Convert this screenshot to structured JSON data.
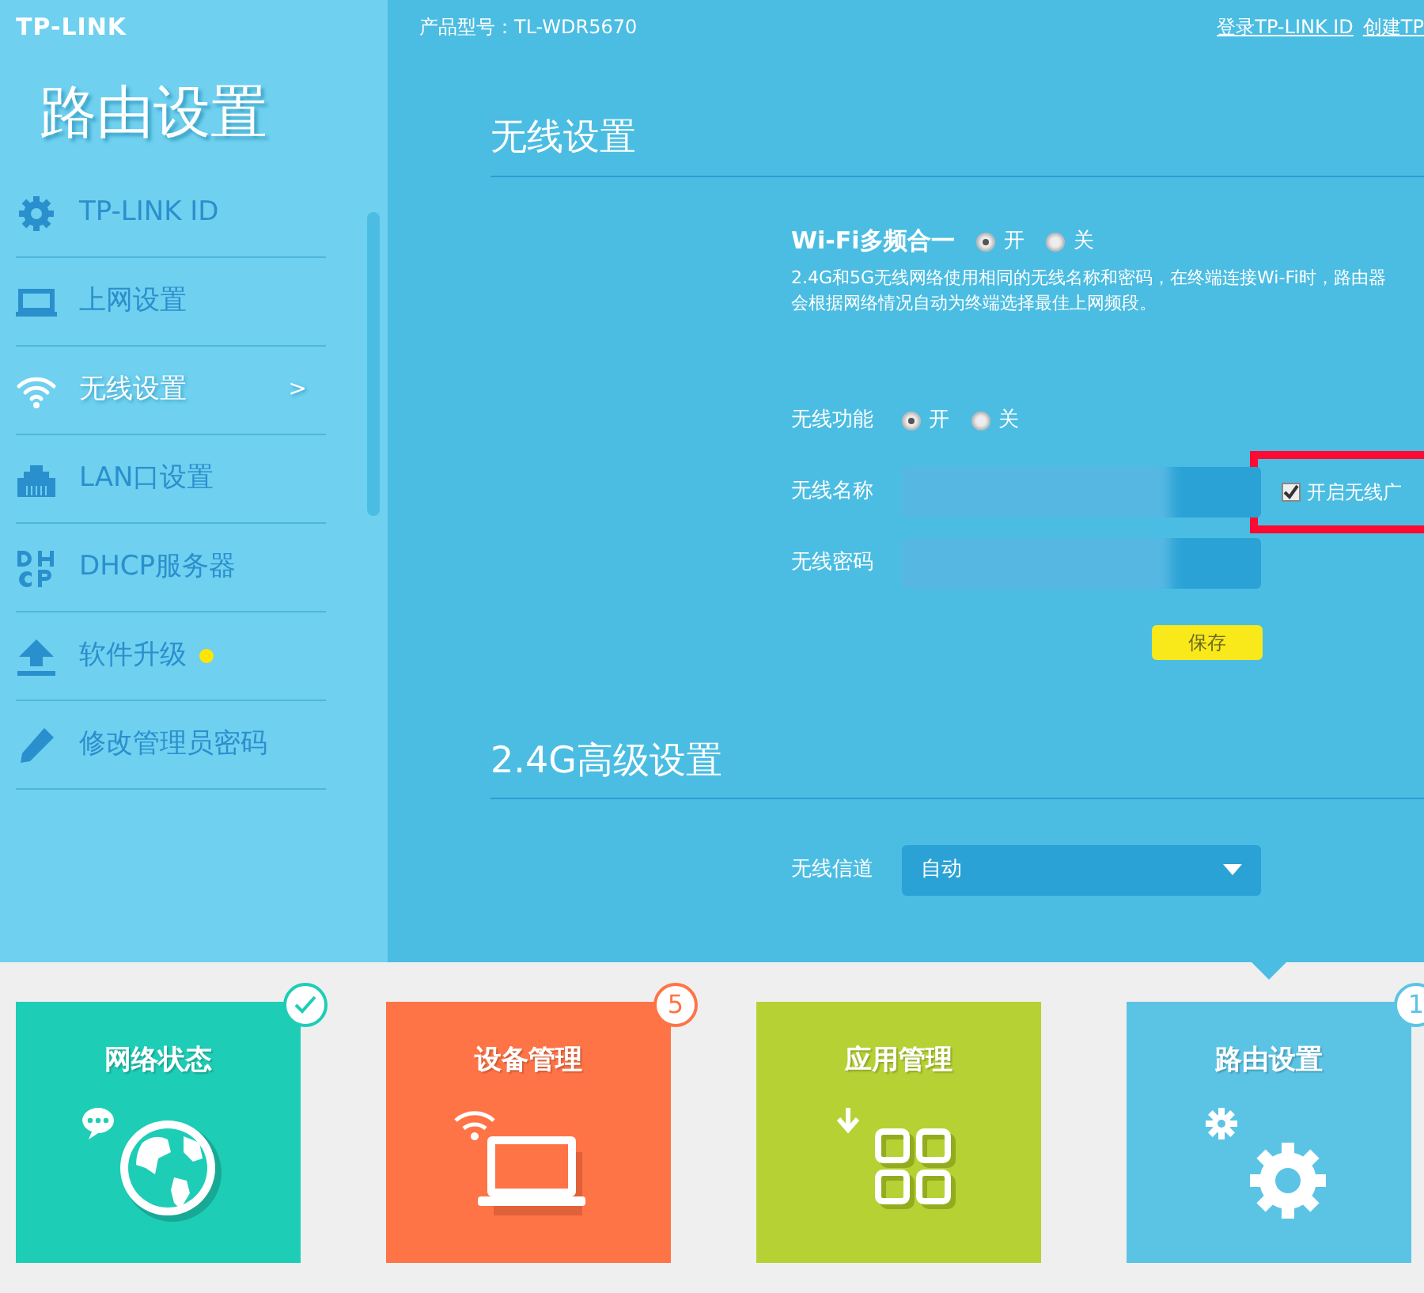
{
  "logo": "TP-LINK",
  "header": {
    "model": "产品型号：TL-WDR5670",
    "links": [
      "登录TP-LINK ID",
      "创建TP"
    ]
  },
  "sidebar": {
    "title": "路由设置",
    "items": [
      {
        "label": "TP-LINK ID",
        "selected": false,
        "notice": false
      },
      {
        "label": "上网设置",
        "selected": false,
        "notice": false
      },
      {
        "label": "无线设置",
        "selected": true,
        "notice": false,
        "arrow": ">"
      },
      {
        "label": "LAN口设置",
        "selected": false,
        "notice": false
      },
      {
        "label": "DHCP服务器",
        "selected": false,
        "notice": false
      },
      {
        "label": "软件升级",
        "selected": false,
        "notice": true
      },
      {
        "label": "修改管理员密码",
        "selected": false,
        "notice": false
      }
    ]
  },
  "sections": [
    {
      "title": "无线设置",
      "rows": [
        {
          "kind": "heading_radio",
          "label": "Wi-Fi多频合一",
          "options": [
            {
              "label": "开",
              "selected": true
            },
            {
              "label": "关",
              "selected": false
            }
          ]
        },
        {
          "kind": "note",
          "text": "2.4G和5G无线网络使用相同的无线名称和密码，在终端连接Wi-Fi时，路由器会根据网络情况自动为终端选择最佳上网频段。"
        },
        {
          "kind": "radio",
          "label": "无线功能",
          "options": [
            {
              "label": "开",
              "selected": true
            },
            {
              "label": "关",
              "selected": false
            }
          ]
        },
        {
          "kind": "text",
          "label": "无线名称",
          "checkbox": {
            "label": "开启无线广",
            "checked": true,
            "highlighted": true
          }
        },
        {
          "kind": "text",
          "label": "无线密码"
        },
        {
          "kind": "button",
          "label": "保存"
        }
      ]
    },
    {
      "title": "2.4G高级设置",
      "rows": [
        {
          "kind": "select",
          "label": "无线信道",
          "value": "自动"
        }
      ]
    }
  ],
  "tiles": [
    {
      "title": "网络状态",
      "color": "#1ecdb6",
      "badge": {
        "kind": "check"
      },
      "selected": false
    },
    {
      "title": "设备管理",
      "color": "#ff7446",
      "badge": {
        "kind": "count",
        "text": "5"
      },
      "selected": false
    },
    {
      "title": "应用管理",
      "color": "#b6d133",
      "selected": false
    },
    {
      "title": "路由设置",
      "color": "#5bc4e5",
      "badge": {
        "kind": "count",
        "text": "1"
      },
      "selected": true
    }
  ]
}
